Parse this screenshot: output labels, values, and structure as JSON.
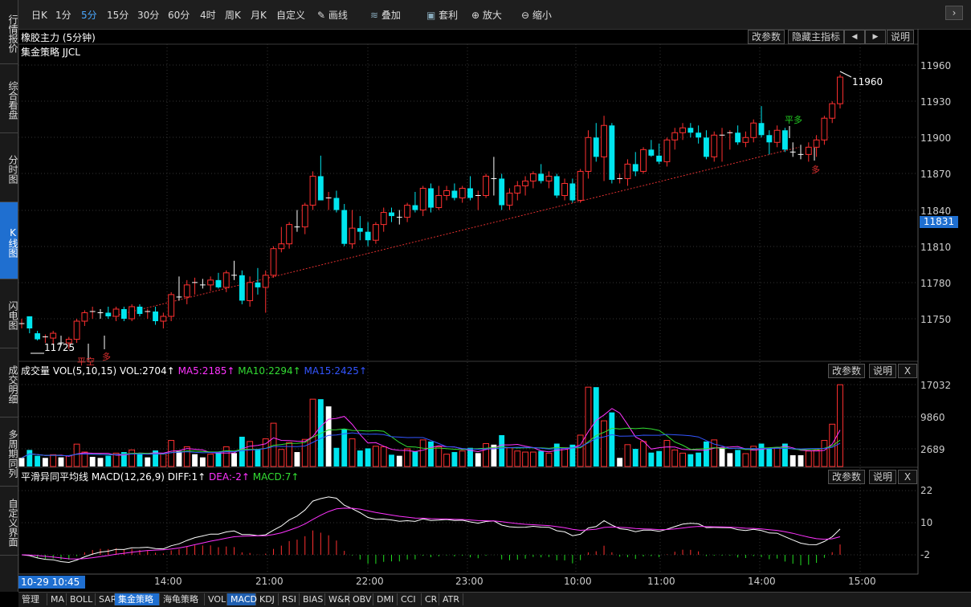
{
  "sidebar": [
    {
      "label": "行情报价",
      "top": 0,
      "h": 80
    },
    {
      "label": "综合看盘",
      "top": 80,
      "h": 86
    },
    {
      "label": "分时图",
      "top": 166,
      "h": 86
    },
    {
      "label": "K线图",
      "top": 252,
      "h": 96,
      "active": true
    },
    {
      "label": "闪电图",
      "top": 348,
      "h": 86
    },
    {
      "label": "成交明细",
      "top": 434,
      "h": 86
    },
    {
      "label": "多周期同列",
      "top": 520,
      "h": 86
    },
    {
      "label": "自定义界面",
      "top": 606,
      "h": 86
    }
  ],
  "toolbar": {
    "periods": [
      "日K",
      "1分",
      "5分",
      "15分",
      "30分",
      "60分",
      "4时",
      "周K",
      "月K",
      "自定义"
    ],
    "active_period": "5分",
    "draw": "画线",
    "overlay": "叠加",
    "arb": "套利",
    "zoom_in": "放大",
    "zoom_out": "缩小",
    "close_btn": "▢",
    "next_btn": "›"
  },
  "main_panel": {
    "title": "橡胶主力 (5分钟)",
    "strategy": "集金策略 JJCL",
    "btn_params": "改参数",
    "btn_hide": "隐藏主指标",
    "btn_left": "◀",
    "btn_right": "▶",
    "btn_help": "说明",
    "yticks": [
      "11960",
      "11930",
      "11900",
      "11870",
      "11840",
      "11810",
      "11780",
      "11750"
    ],
    "current_price": "11831",
    "high_label": "11960",
    "low_label": "11725",
    "signals": [
      {
        "text": "平空",
        "color": "#e03030"
      },
      {
        "text": "多",
        "color": "#e03030"
      },
      {
        "text": "平多",
        "color": "#22cc22"
      },
      {
        "text": "多",
        "color": "#e03030"
      }
    ]
  },
  "volume_panel": {
    "label": "成交量",
    "vol": "VOL(5,10,15)",
    "vol_val": "VOL:2704↑",
    "ma5": "MA5:2185↑",
    "ma10": "MA10:2294↑",
    "ma15": "MA15:2425↑",
    "colors": {
      "ma5": "#ff33ff",
      "ma10": "#33dd33",
      "ma15": "#3355ff"
    },
    "yticks": [
      "17032",
      "9860",
      "2689"
    ],
    "btn_params": "改参数",
    "btn_help": "说明",
    "btn_close": "X"
  },
  "macd_panel": {
    "label": "平滑异同平均线 MACD(12,26,9)",
    "diff": "DIFF:1↑",
    "dea": "DEA:-2↑",
    "macd": "MACD:7↑",
    "colors": {
      "dea": "#ff33ff",
      "macd": "#33dd33"
    },
    "yticks": [
      "22",
      "10",
      "-2"
    ],
    "btn_params": "改参数",
    "btn_help": "说明",
    "btn_close": "X"
  },
  "time_axis": {
    "cursor": "10-29 10:45",
    "ticks": [
      "14:00",
      "21:00",
      "22:00",
      "23:00",
      "10:00",
      "11:00",
      "14:00",
      "15:00"
    ]
  },
  "bottom_tabs": [
    "管理",
    "MA",
    "BOLL",
    "SAR",
    "集金策略",
    "海龟策略",
    "VOL",
    "MACD",
    "KDJ",
    "RSI",
    "BIAS",
    "W&R",
    "OBV",
    "DMI",
    "CCI",
    "CR",
    "ATR"
  ],
  "bottom_active": "集金策略",
  "bottom_selected": "MACD",
  "chart_data": {
    "type": "candlestick",
    "ohlc": [
      [
        11745,
        11750,
        11742,
        11746
      ],
      [
        11752,
        11752,
        11738,
        11742
      ],
      [
        11738,
        11740,
        11732,
        11733
      ],
      [
        11733,
        11737,
        11730,
        11735
      ],
      [
        11734,
        11740,
        11729,
        11738
      ],
      [
        11732,
        11736,
        11728,
        11730
      ],
      [
        11730,
        11735,
        11725,
        11733
      ],
      [
        11733,
        11750,
        11730,
        11748
      ],
      [
        11748,
        11757,
        11744,
        11755
      ],
      [
        11755,
        11760,
        11750,
        11756
      ],
      [
        11756,
        11758,
        11750,
        11755
      ],
      [
        11755,
        11760,
        11750,
        11752
      ],
      [
        11752,
        11760,
        11748,
        11758
      ],
      [
        11758,
        11760,
        11748,
        11750
      ],
      [
        11750,
        11762,
        11748,
        11760
      ],
      [
        11760,
        11762,
        11752,
        11754
      ],
      [
        11754,
        11758,
        11750,
        11756
      ],
      [
        11756,
        11760,
        11745,
        11748
      ],
      [
        11748,
        11755,
        11742,
        11752
      ],
      [
        11752,
        11772,
        11748,
        11770
      ],
      [
        11770,
        11785,
        11765,
        11768
      ],
      [
        11768,
        11782,
        11762,
        11778
      ],
      [
        11778,
        11784,
        11770,
        11780
      ],
      [
        11780,
        11783,
        11775,
        11778
      ],
      [
        11778,
        11785,
        11773,
        11782
      ],
      [
        11782,
        11788,
        11775,
        11776
      ],
      [
        11776,
        11790,
        11772,
        11788
      ],
      [
        11788,
        11798,
        11782,
        11786
      ],
      [
        11786,
        11790,
        11762,
        11765
      ],
      [
        11765,
        11785,
        11760,
        11780
      ],
      [
        11780,
        11792,
        11770,
        11776
      ],
      [
        11776,
        11790,
        11755,
        11786
      ],
      [
        11786,
        11810,
        11784,
        11808
      ],
      [
        11808,
        11826,
        11805,
        11812
      ],
      [
        11812,
        11830,
        11808,
        11828
      ],
      [
        11828,
        11840,
        11822,
        11826
      ],
      [
        11826,
        11846,
        11820,
        11844
      ],
      [
        11844,
        11872,
        11840,
        11868
      ],
      [
        11868,
        11885,
        11860,
        11848
      ],
      [
        11848,
        11855,
        11840,
        11850
      ],
      [
        11850,
        11856,
        11838,
        11840
      ],
      [
        11840,
        11845,
        11810,
        11812
      ],
      [
        11812,
        11840,
        11808,
        11825
      ],
      [
        11825,
        11835,
        11815,
        11822
      ],
      [
        11822,
        11830,
        11810,
        11815
      ],
      [
        11815,
        11830,
        11812,
        11828
      ],
      [
        11828,
        11842,
        11822,
        11838
      ],
      [
        11838,
        11842,
        11830,
        11835
      ],
      [
        11835,
        11840,
        11828,
        11834
      ],
      [
        11834,
        11846,
        11830,
        11844
      ],
      [
        11844,
        11855,
        11838,
        11840
      ],
      [
        11840,
        11860,
        11835,
        11858
      ],
      [
        11858,
        11862,
        11838,
        11842
      ],
      [
        11842,
        11860,
        11840,
        11852
      ],
      [
        11852,
        11860,
        11848,
        11856
      ],
      [
        11856,
        11862,
        11848,
        11850
      ],
      [
        11850,
        11860,
        11846,
        11858
      ],
      [
        11858,
        11868,
        11848,
        11850
      ],
      [
        11850,
        11856,
        11840,
        11852
      ],
      [
        11852,
        11870,
        11850,
        11868
      ],
      [
        11868,
        11884,
        11852,
        11866
      ],
      [
        11866,
        11870,
        11840,
        11844
      ],
      [
        11844,
        11858,
        11840,
        11854
      ],
      [
        11854,
        11864,
        11848,
        11860
      ],
      [
        11860,
        11868,
        11852,
        11864
      ],
      [
        11864,
        11872,
        11858,
        11870
      ],
      [
        11870,
        11878,
        11862,
        11864
      ],
      [
        11864,
        11872,
        11858,
        11868
      ],
      [
        11868,
        11870,
        11850,
        11852
      ],
      [
        11852,
        11866,
        11848,
        11862
      ],
      [
        11862,
        11866,
        11846,
        11848
      ],
      [
        11848,
        11874,
        11846,
        11872
      ],
      [
        11872,
        11906,
        11866,
        11900
      ],
      [
        11900,
        11912,
        11880,
        11884
      ],
      [
        11884,
        11918,
        11864,
        11910
      ],
      [
        11910,
        11912,
        11862,
        11865
      ],
      [
        11865,
        11870,
        11862,
        11866
      ],
      [
        11866,
        11882,
        11860,
        11878
      ],
      [
        11878,
        11888,
        11868,
        11872
      ],
      [
        11872,
        11892,
        11870,
        11890
      ],
      [
        11890,
        11898,
        11884,
        11885
      ],
      [
        11885,
        11895,
        11878,
        11880
      ],
      [
        11880,
        11900,
        11876,
        11898
      ],
      [
        11898,
        11908,
        11890,
        11904
      ],
      [
        11904,
        11912,
        11898,
        11908
      ],
      [
        11908,
        11912,
        11900,
        11904
      ],
      [
        11904,
        11910,
        11895,
        11900
      ],
      [
        11900,
        11906,
        11882,
        11884
      ],
      [
        11884,
        11905,
        11880,
        11902
      ],
      [
        11902,
        11908,
        11880,
        11902
      ],
      [
        11902,
        11906,
        11890,
        11904
      ],
      [
        11904,
        11910,
        11894,
        11896
      ],
      [
        11896,
        11905,
        11892,
        11900
      ],
      [
        11900,
        11915,
        11896,
        11912
      ],
      [
        11912,
        11926,
        11900,
        11902
      ],
      [
        11902,
        11906,
        11886,
        11896
      ],
      [
        11896,
        11910,
        11892,
        11906
      ],
      [
        11906,
        11908,
        11888,
        11890
      ],
      [
        11890,
        11896,
        11884,
        11888
      ],
      [
        11888,
        11894,
        11882,
        11886
      ],
      [
        11886,
        11896,
        11880,
        11892
      ],
      [
        11892,
        11902,
        11884,
        11898
      ],
      [
        11898,
        11918,
        11894,
        11916
      ],
      [
        11916,
        11930,
        11912,
        11928
      ],
      [
        11928,
        11952,
        11924,
        11950
      ]
    ],
    "volume_max": 17032
  }
}
